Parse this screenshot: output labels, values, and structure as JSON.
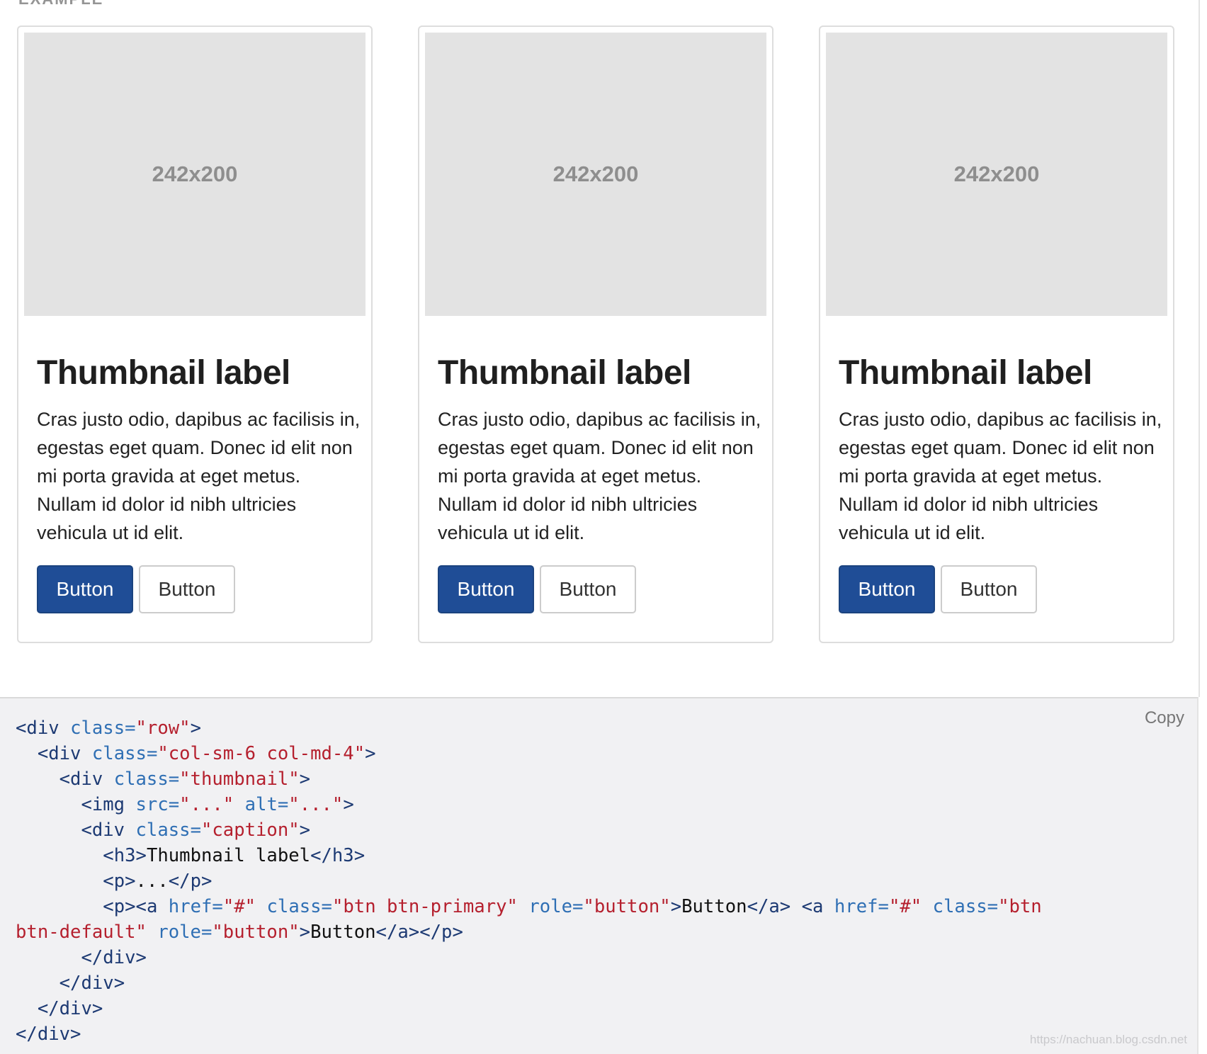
{
  "example": {
    "label": "EXAMPLE"
  },
  "thumbnails": [
    {
      "placeholder": "242x200",
      "title": "Thumbnail label",
      "text": "Cras justo odio, dapibus ac facilisis in, egestas eget quam. Donec id elit non mi porta gravida at eget metus. Nullam id dolor id nibh ultricies vehicula ut id elit.",
      "primary_button": "Button",
      "default_button": "Button"
    },
    {
      "placeholder": "242x200",
      "title": "Thumbnail label",
      "text": "Cras justo odio, dapibus ac facilisis in, egestas eget quam. Donec id elit non mi porta gravida at eget metus. Nullam id dolor id nibh ultricies vehicula ut id elit.",
      "primary_button": "Button",
      "default_button": "Button"
    },
    {
      "placeholder": "242x200",
      "title": "Thumbnail label",
      "text": "Cras justo odio, dapibus ac facilisis in, egestas eget quam. Donec id elit non mi porta gravida at eget metus. Nullam id dolor id nibh ultricies vehicula ut id elit.",
      "primary_button": "Button",
      "default_button": "Button"
    }
  ],
  "code": {
    "copy_label": "Copy",
    "lines": [
      "<div class=\"row\">",
      "  <div class=\"col-sm-6 col-md-4\">",
      "    <div class=\"thumbnail\">",
      "      <img src=\"...\" alt=\"...\">",
      "      <div class=\"caption\">",
      "        <h3>Thumbnail label</h3>",
      "        <p>...</p>",
      "        <p><a href=\"#\" class=\"btn btn-primary\" role=\"button\">Button</a> <a href=\"#\" class=\"btn",
      "btn-default\" role=\"button\">Button</a></p>",
      "      </div>",
      "    </div>",
      "  </div>",
      "</div>"
    ]
  },
  "watermark": "https://nachuan.blog.csdn.net",
  "colors": {
    "primary_button": "#1f4d96",
    "code_tag": "#1d3a73",
    "code_attr": "#2f6fb4",
    "code_value": "#b5202e",
    "code_background": "#f1f1f3"
  }
}
